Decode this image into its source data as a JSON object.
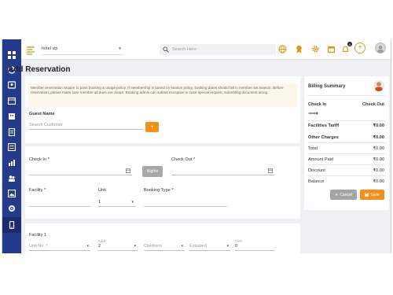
{
  "topbar": {
    "hotel_value": "hotel vip",
    "search_placeholder": "Search Here",
    "notification_count": "0"
  },
  "page": {
    "title": "Add Reservation"
  },
  "notice": {
    "text": "Member reservation require to pass booking & usage policy. If membership is based on season policy, booking dates should fall in member set season. Before reservation, please make sure member all dues are clears. Booking admin can submit exception in case special request, submitting document along."
  },
  "guest": {
    "label": "Guest Name",
    "search_placeholder": "Search Customer",
    "add_button": "+"
  },
  "dates": {
    "check_in_label": "Check In *",
    "check_out_label": "Check Out *",
    "nights_button": "Nights",
    "facility_label": "Facility *",
    "unit_label": "Unit",
    "unit_value": "1",
    "booking_type_label": "Booking Type *"
  },
  "facility_section": {
    "title": "Facility 1",
    "unit_no_placeholder": "Unit No. *",
    "adult_label": "Adult",
    "adult_value": "2",
    "children_placeholder": "Childrens",
    "extrabed_placeholder": "Extrabed",
    "cost_label": "Cost",
    "cost_value": "0"
  },
  "billing": {
    "title": "Billing Summary",
    "check_in": "Check In",
    "check_out": "Check Out",
    "arrow": "⟶",
    "rows": [
      {
        "label": "Facilities Tariff",
        "amount": "₹0.00"
      },
      {
        "label": "Other Charges",
        "amount": "₹0.00"
      },
      {
        "label": "Total",
        "amount": "₹0.00"
      },
      {
        "label": "Amount Paid",
        "amount": "₹0.00"
      },
      {
        "label": "Discount",
        "amount": "₹0.00"
      },
      {
        "label": "Balance",
        "amount": "₹0.00"
      }
    ],
    "cancel_button": "Cancel",
    "save_button": "Save"
  },
  "colors": {
    "sidebar": "#243b8c",
    "accent": "#f39019",
    "notice_bg": "#fbf6ea"
  },
  "icons": {
    "sidebar": [
      "grid-icon",
      "speedometer-icon",
      "user-card-icon",
      "calendar-icon",
      "building-icon",
      "receipt-icon",
      "list-icon",
      "chart-icon",
      "people-icon",
      "image-icon",
      "settings-icon",
      "mobile-icon"
    ],
    "topbar": [
      "globe-icon",
      "award-icon",
      "gear-icon",
      "calendar-icon",
      "bell-icon",
      "plus-icon"
    ]
  }
}
